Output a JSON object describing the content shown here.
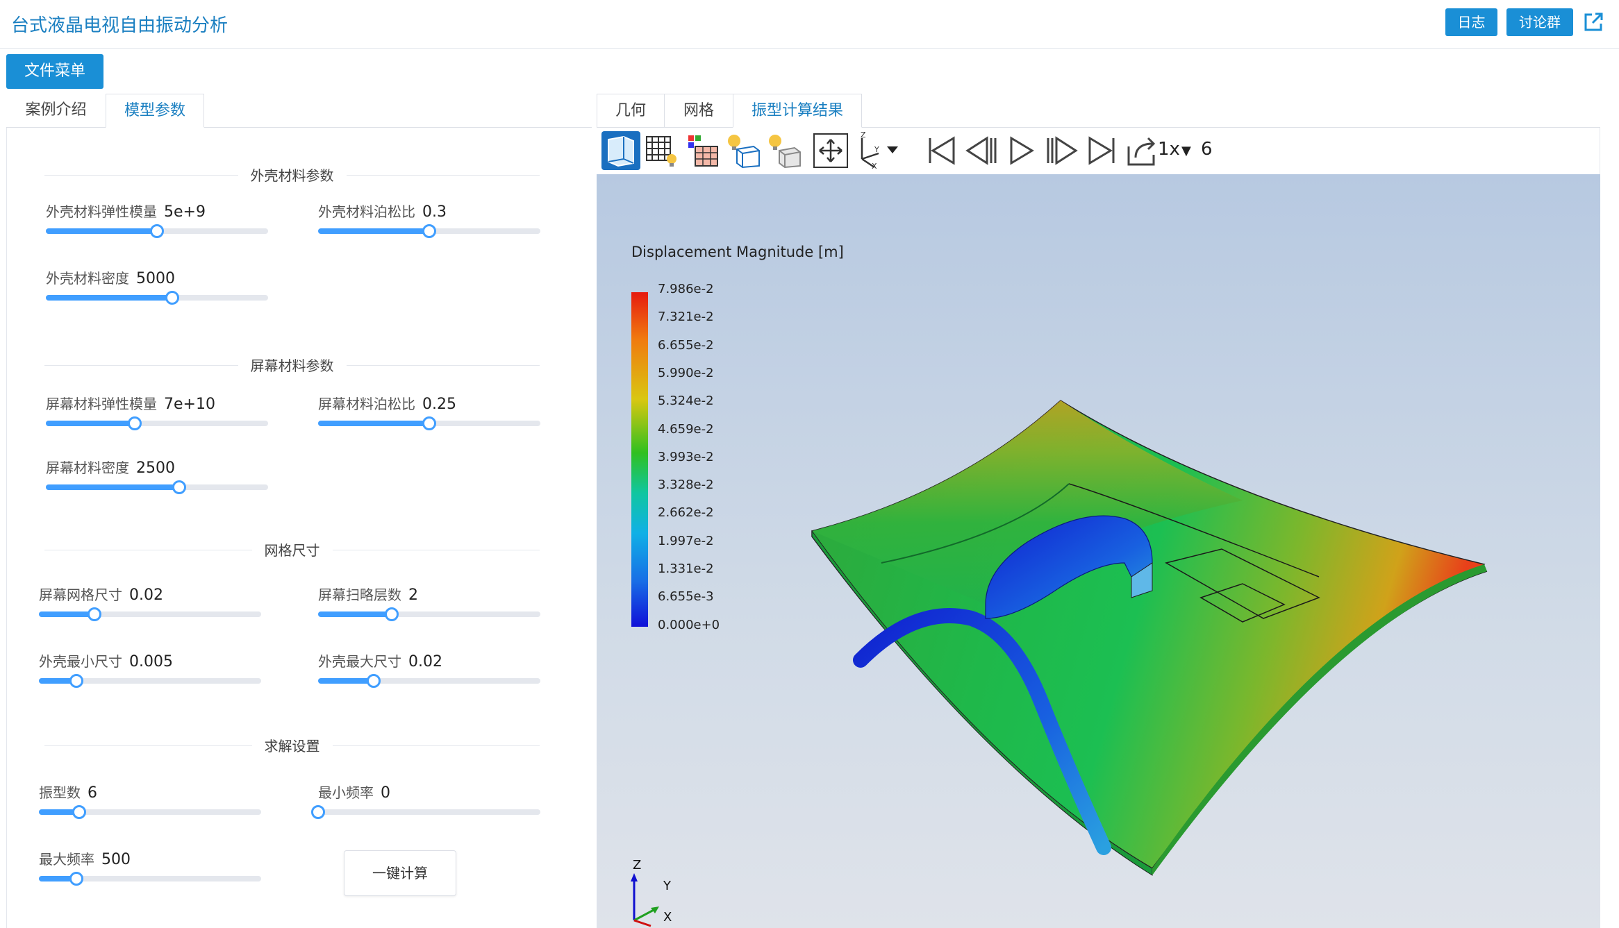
{
  "app": {
    "title": "台式液晶电视自由振动分析",
    "log_label": "日志",
    "chat_label": "讨论群",
    "file_menu_label": "文件菜单"
  },
  "left_tabs": [
    "案例介绍",
    "模型参数"
  ],
  "sections": {
    "shell": "外壳材料参数",
    "screen": "屏幕材料参数",
    "mesh": "网格尺寸",
    "solver": "求解设置"
  },
  "params": {
    "shell_modulus": {
      "label": "外壳材料弹性模量",
      "value": "5e+9",
      "level": 0.5
    },
    "shell_poisson": {
      "label": "外壳材料泊松比",
      "value": "0.3",
      "level": 0.5
    },
    "shell_density": {
      "label": "外壳材料密度",
      "value": "5000",
      "level": 0.57
    },
    "screen_modulus": {
      "label": "屏幕材料弹性模量",
      "value": "7e+10",
      "level": 0.4
    },
    "screen_poisson": {
      "label": "屏幕材料泊松比",
      "value": "0.25",
      "level": 0.5
    },
    "screen_density": {
      "label": "屏幕材料密度",
      "value": "2500",
      "level": 0.6
    },
    "screen_mesh": {
      "label": "屏幕网格尺寸",
      "value": "0.02",
      "level": 0.25
    },
    "sweep_layers": {
      "label": "屏幕扫略层数",
      "value": "2",
      "level": 0.33
    },
    "shell_min": {
      "label": "外壳最小尺寸",
      "value": "0.005",
      "level": 0.17
    },
    "shell_max": {
      "label": "外壳最大尺寸",
      "value": "0.02",
      "level": 0.25
    },
    "mode_count": {
      "label": "振型数",
      "value": "6",
      "level": 0.18
    },
    "min_freq": {
      "label": "最小频率",
      "value": "0",
      "level": 0.0
    },
    "max_freq": {
      "label": "最大频率",
      "value": "500",
      "level": 0.17
    }
  },
  "calc_button_label": "一键计算",
  "right_tabs": [
    "几何",
    "网格",
    "振型计算结果"
  ],
  "toolbar": {
    "icons": [
      "surface-view-icon",
      "mesh-view-icon",
      "color-map-icon",
      "wireframe-light-icon",
      "box-light-icon",
      "fit-view-icon",
      "axis-orient-icon",
      "first-frame-icon",
      "prev-frame-icon",
      "play-icon",
      "next-frame-icon",
      "last-frame-icon",
      "export-icon"
    ],
    "speed_label": "1x",
    "mode_number": "6"
  },
  "viewport": {
    "legend_title": "Displacement Magnitude [m]",
    "legend_values": [
      "7.986e-2",
      "7.321e-2",
      "6.655e-2",
      "5.990e-2",
      "5.324e-2",
      "4.659e-2",
      "3.993e-2",
      "3.328e-2",
      "2.662e-2",
      "1.997e-2",
      "1.331e-2",
      "6.655e-3",
      "0.000e+0"
    ],
    "axis_labels": {
      "z": "Z",
      "y": "Y",
      "x": "X"
    }
  },
  "colors": {
    "accent": "#1a8fd6",
    "slider": "#409eff",
    "title": "#1a7fc1"
  }
}
